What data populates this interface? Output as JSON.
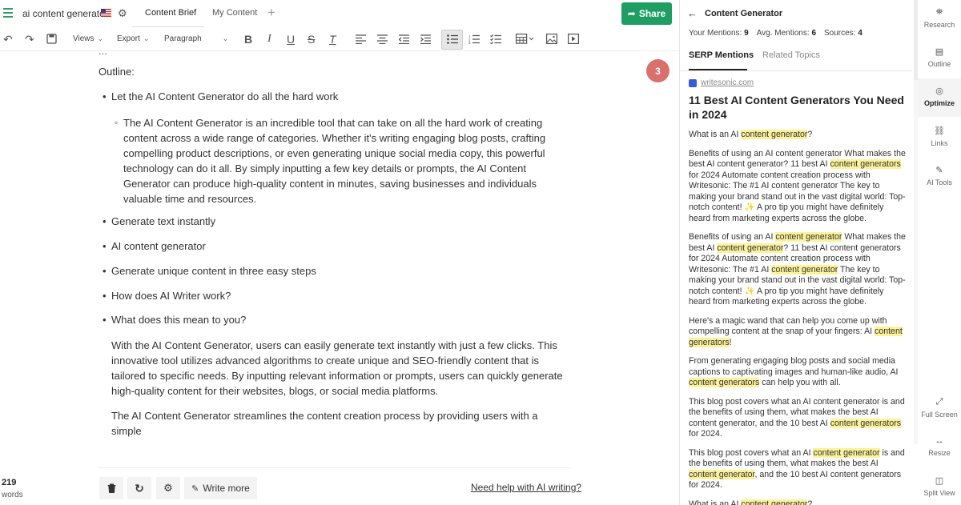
{
  "header": {
    "doc_title": "ai content generator",
    "tabs": [
      "Content Brief",
      "My Content"
    ],
    "add_tab": "+",
    "share_label": "Share"
  },
  "toolbar": {
    "views_label": "Views",
    "export_label": "Export",
    "paragraph_label": "Paragraph"
  },
  "editor": {
    "clipped_top": "...",
    "outline_label": "Outline:",
    "badge_count": "3",
    "bullets": [
      "Let the AI Content Generator do all the hard work",
      "Generate text instantly",
      "AI content generator",
      "Generate unique content in three easy steps",
      "How does AI Writer work?",
      "What does this mean to you?"
    ],
    "sub_bullet": "The AI Content Generator is an incredible tool that can take on all the hard work of creating content across a wide range of categories. Whether it's writing engaging blog posts, crafting compelling product descriptions, or even generating unique social media copy, this powerful technology can do it all. By simply inputting a few key details or prompts, the AI Content Generator can produce high-quality content in minutes, saving businesses and individuals valuable time and resources.",
    "paragraphs": [
      "With the AI Content Generator, users can easily generate text instantly with just a few clicks. This innovative tool utilizes advanced algorithms to create unique and SEO-friendly content that is tailored to specific needs. By inputting relevant information or prompts, users can quickly generate high-quality content for their websites, blogs, or social media platforms.",
      "The AI Content Generator streamlines the content creation process by providing users with a simple"
    ]
  },
  "bottom": {
    "word_count": "219",
    "word_label": "words",
    "write_more_label": "Write more",
    "help_link": "Need help with AI writing?"
  },
  "panel": {
    "title": "Content Generator",
    "stats": {
      "your_mentions_label": "Your Mentions:",
      "your_mentions": "9",
      "avg_mentions_label": "Avg. Mentions:",
      "avg_mentions": "6",
      "sources_label": "Sources:",
      "sources": "4"
    },
    "tabs": [
      "SERP Mentions",
      "Related Topics"
    ],
    "source_domain": "writesonic.com",
    "source_heading": "11 Best AI Content Generators You Need in 2024"
  },
  "rail": {
    "items": [
      "Research",
      "Outline",
      "Optimize",
      "Links",
      "AI Tools",
      "Full Screen",
      "Resize",
      "Split View"
    ]
  },
  "colors": {
    "share_green": "#1e9e63",
    "badge_red": "#d9706b",
    "highlight_yellow": "#fbf29a"
  }
}
